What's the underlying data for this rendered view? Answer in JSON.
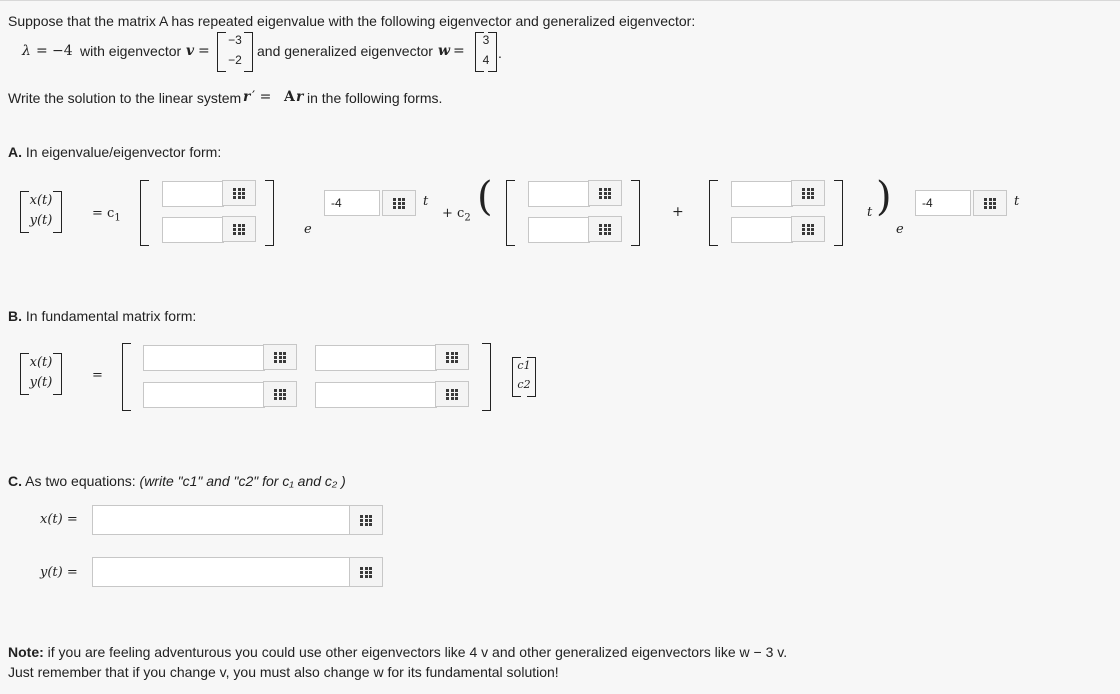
{
  "intro": {
    "line1": "Suppose that the matrix A has repeated eigenvalue with the following eigenvector and generalized eigenvector:",
    "lambda_sym": "λ",
    "eq": "=",
    "lambda_val": "−4",
    "with_eigenvector": "with eigenvector",
    "v_sym": "v",
    "v_vec": [
      "−3",
      "−2"
    ],
    "and_generalized": "and generalized eigenvector",
    "w_sym": "w",
    "w_vec": [
      "3",
      "4"
    ],
    "period": "."
  },
  "task": {
    "prefix": "Write the solution to the linear system",
    "r_sym": "r",
    "prime_eq": "′ =",
    "A_sym": "A",
    "suffix": "in the following forms."
  },
  "xy": {
    "x": "x(t)",
    "y": "y(t)",
    "equals": "="
  },
  "partA": {
    "label": "A.",
    "title": "In eigenvalue/eigenvector form:",
    "c1": "= c",
    "c1_sub": "1",
    "e": "e",
    "t": "t",
    "exp1_value": "-4",
    "plus_c2": "+ c",
    "c2_sub": "2",
    "lparen": "(",
    "rparen": ")",
    "plus": "+",
    "t_mid": "t",
    "exp2_value": "-4"
  },
  "partB": {
    "label": "B.",
    "title": "In fundamental matrix form:",
    "c_vec": [
      "c1",
      "c2"
    ]
  },
  "partC": {
    "label": "C.",
    "title": "As two equations:",
    "hint": "(write \"c1\" and \"c2\" for c₁ and c₂ )",
    "x_label": "x(t) =",
    "y_label": "y(t) ="
  },
  "note": {
    "label": "Note:",
    "line1": "if you are feeling adventurous you could use other eigenvectors like 4 v and other generalized eigenvectors like w − 3 v.",
    "line2": "Just remember that if you change v, you must also change w for its fundamental solution!"
  },
  "icons": {
    "matrix_picker": "grid-icon"
  }
}
